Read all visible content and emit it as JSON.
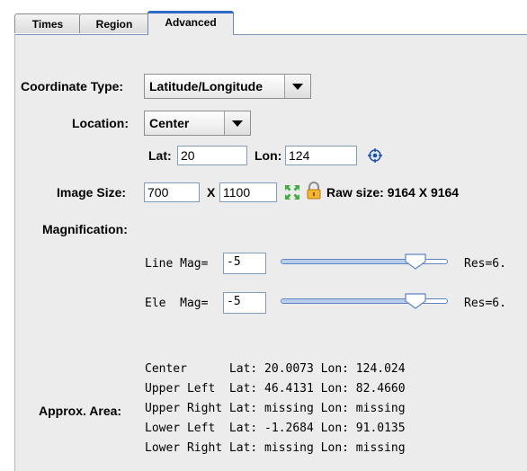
{
  "tabs": [
    {
      "label": "Times"
    },
    {
      "label": "Region"
    },
    {
      "label": "Advanced"
    }
  ],
  "coordinate_type": {
    "label": "Coordinate Type:",
    "value": "Latitude/Longitude"
  },
  "location": {
    "label": "Location:",
    "value": "Center",
    "lat_label": "Lat:",
    "lat_value": "20",
    "lon_label": "Lon:",
    "lon_value": "124"
  },
  "image_size": {
    "label": "Image Size:",
    "width": "700",
    "x_label": "X",
    "height": "1100",
    "raw_size": "Raw size: 9164 X 9164"
  },
  "magnification": {
    "label": "Magnification:",
    "line": {
      "label": "Line Mag=",
      "value": "-5",
      "res": "Res=6."
    },
    "ele": {
      "label": "Ele  Mag=",
      "value": "-5",
      "res": "Res=6."
    }
  },
  "approx_area": {
    "label": "Approx. Area:",
    "rows": [
      "Center      Lat: 20.0073 Lon: 124.024",
      "Upper Left  Lat: 46.4131 Lon: 82.4660",
      "Upper Right Lat: missing Lon: missing",
      "Lower Left  Lat: -1.2684 Lon: 91.0135",
      "Lower Right Lat: missing Lon: missing"
    ]
  },
  "icons": {
    "locate": "crosshair-target-icon",
    "resize": "expand-arrows-icon",
    "lock": "padlock-icon"
  },
  "colors": {
    "accent": "#2f6ac4",
    "panel": "#ececec",
    "field_border": "#7f9db9"
  }
}
